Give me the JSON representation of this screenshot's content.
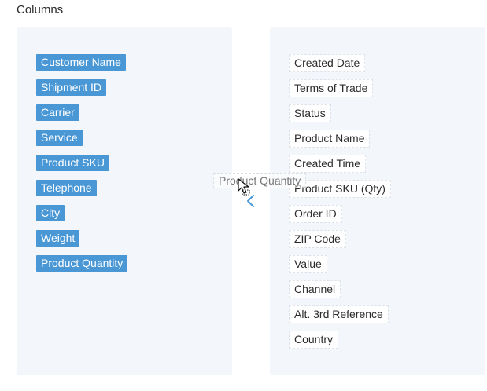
{
  "section_title": "Columns",
  "selected_columns": [
    {
      "label": "Customer Name"
    },
    {
      "label": "Shipment ID"
    },
    {
      "label": "Carrier"
    },
    {
      "label": "Service"
    },
    {
      "label": "Product SKU"
    },
    {
      "label": "Telephone"
    },
    {
      "label": "City"
    },
    {
      "label": "Weight"
    },
    {
      "label": "Product Quantity"
    }
  ],
  "available_columns": [
    {
      "label": "Created Date"
    },
    {
      "label": "Terms of Trade"
    },
    {
      "label": "Status"
    },
    {
      "label": "Product Name"
    },
    {
      "label": "Created Time"
    },
    {
      "label": "Product SKU (Qty)"
    },
    {
      "label": "Order ID"
    },
    {
      "label": "ZIP Code"
    },
    {
      "label": "Value"
    },
    {
      "label": "Channel"
    },
    {
      "label": "Alt. 3rd Reference"
    },
    {
      "label": "Country"
    }
  ],
  "dragging_item": {
    "label": "Product Quantity"
  },
  "icons": {
    "move_arrow": "chevron-left-icon",
    "cursor": "grab-cursor-icon"
  },
  "colors": {
    "selected_chip": "#4a97d6",
    "panel_background": "#f3f6fa",
    "arrow": "#4a97d6"
  }
}
